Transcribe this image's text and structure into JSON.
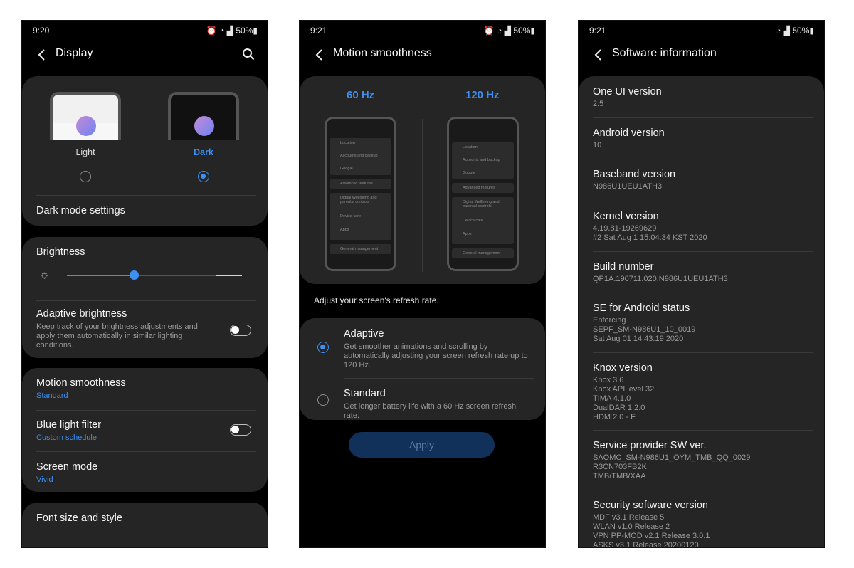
{
  "status": {
    "phone1_time": "9:20",
    "phone2_time": "9:21",
    "phone3_time": "9:21",
    "battery": "50%"
  },
  "display": {
    "title": "Display",
    "theme_light": "Light",
    "theme_dark": "Dark",
    "theme_selected": "Dark",
    "dark_mode_settings": "Dark mode settings",
    "brightness": "Brightness",
    "brightness_level": 0.45,
    "adaptive_brightness": "Adaptive brightness",
    "adaptive_brightness_desc": "Keep track of your brightness adjustments and apply them automatically in similar lighting conditions.",
    "motion_smoothness": "Motion smoothness",
    "motion_smoothness_value": "Standard",
    "blue_light_filter": "Blue light filter",
    "blue_light_filter_value": "Custom schedule",
    "screen_mode": "Screen mode",
    "screen_mode_value": "Vivid",
    "font_size": "Font size and style"
  },
  "motion": {
    "title": "Motion smoothness",
    "hz60": "60 Hz",
    "hz120": "120 Hz",
    "preview_items": [
      "Location",
      "Accounts and backup",
      "Google",
      "Advanced features",
      "Digital Wellbeing and parental controls",
      "Device care",
      "Apps",
      "General management"
    ],
    "caption": "Adjust your screen's refresh rate.",
    "adaptive_label": "Adaptive",
    "adaptive_desc": "Get smoother animations and scrolling by automatically adjusting your screen refresh rate up to 120 Hz.",
    "standard_label": "Standard",
    "standard_desc": "Get longer battery life with a 60 Hz screen refresh rate.",
    "selected": "Adaptive",
    "apply": "Apply"
  },
  "software": {
    "title": "Software information",
    "items": [
      {
        "label": "One UI version",
        "value": "2.5"
      },
      {
        "label": "Android version",
        "value": "10"
      },
      {
        "label": "Baseband version",
        "value": "N986U1UEU1ATH3"
      },
      {
        "label": "Kernel version",
        "value": "4.19.81-19269629\n#2 Sat Aug 1 15:04:34 KST 2020"
      },
      {
        "label": "Build number",
        "value": "QP1A.190711.020.N986U1UEU1ATH3"
      },
      {
        "label": "SE for Android status",
        "value": "Enforcing\nSEPF_SM-N986U1_10_0019\nSat Aug 01 14:43:19 2020"
      },
      {
        "label": "Knox version",
        "value": "Knox 3.6\nKnox API level 32\nTIMA 4.1.0\nDualDAR 1.2.0\nHDM 2.0 - F"
      },
      {
        "label": "Service provider SW ver.",
        "value": "SAOMC_SM-N986U1_OYM_TMB_QQ_0029\nR3CN703FB2K\nTMB/TMB/XAA"
      },
      {
        "label": "Security software version",
        "value": "MDF v3.1 Release 5\nWLAN v1.0 Release 2\nVPN PP-MOD v2.1 Release 3.0.1\nASKS v3.1 Release 20200120"
      }
    ]
  },
  "colors": {
    "accent": "#3d8ff2",
    "card": "#252525",
    "background": "#000000"
  }
}
